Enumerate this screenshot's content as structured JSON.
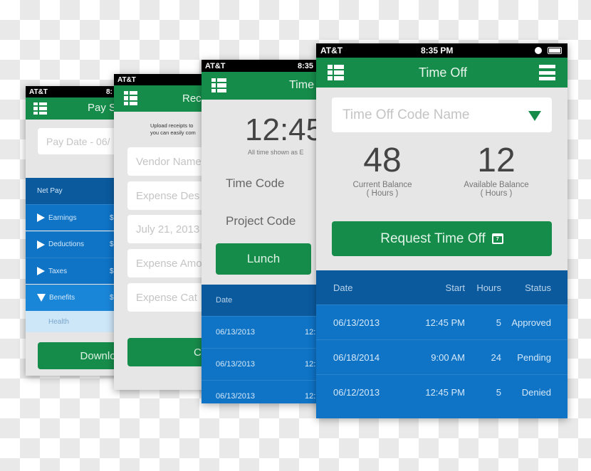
{
  "colors": {
    "green": "#168c4a",
    "dark_blue": "#0b5a9e",
    "blue": "#0f73c6",
    "light_blue": "#cde6f8"
  },
  "carrier": "AT&T",
  "pay_screen": {
    "time": "8:",
    "title": "Pay S",
    "pay_date": "Pay Date - 06/",
    "net_pay": "Net Pay",
    "rows": [
      {
        "label": "Earnings",
        "value": "$"
      },
      {
        "label": "Deductions",
        "value": "$"
      },
      {
        "label": "Taxes",
        "value": "$"
      },
      {
        "label": "Benefits",
        "value": "$"
      }
    ],
    "sub_row": "Health",
    "download": "Download P"
  },
  "receipt_screen": {
    "title": "Rec",
    "intro_1": "Upload receipts to",
    "intro_2": "you can easily com",
    "fields": [
      "Vendor Name",
      "Expense Des",
      "July 21, 2013",
      "Expense Amo",
      "Expense Cat"
    ],
    "button": "C"
  },
  "clock_screen": {
    "time": "8:35",
    "title": "Time",
    "clock": "12:45",
    "note": "All time shown as E",
    "time_code": "Time Code",
    "project_code": "Project Code",
    "lunch": "Lunch",
    "table_header": "Date",
    "rows": [
      {
        "date": "06/13/2013",
        "start": "12:"
      },
      {
        "date": "06/13/2013",
        "start": "12:"
      },
      {
        "date": "06/13/2013",
        "start": "12:"
      }
    ]
  },
  "timeoff_screen": {
    "time": "8:35 PM",
    "title": "Time Off",
    "dropdown_placeholder": "Time Off Code Name",
    "current_balance": {
      "value": "48",
      "label": "Current Balance",
      "unit": "( Hours )"
    },
    "available_balance": {
      "value": "12",
      "label": "Available Balance",
      "unit": "( Hours )"
    },
    "request_button": "Request Time Off",
    "calendar_day": "7",
    "table": {
      "headers": [
        "Date",
        "Start",
        "Hours",
        "Status"
      ],
      "rows": [
        {
          "date": "06/13/2013",
          "start": "12:45 PM",
          "hours": "5",
          "status": "Approved"
        },
        {
          "date": "06/18/2014",
          "start": "9:00 AM",
          "hours": "24",
          "status": "Pending"
        },
        {
          "date": "06/12/2013",
          "start": "12:45 PM",
          "hours": "5",
          "status": "Denied"
        }
      ]
    }
  }
}
